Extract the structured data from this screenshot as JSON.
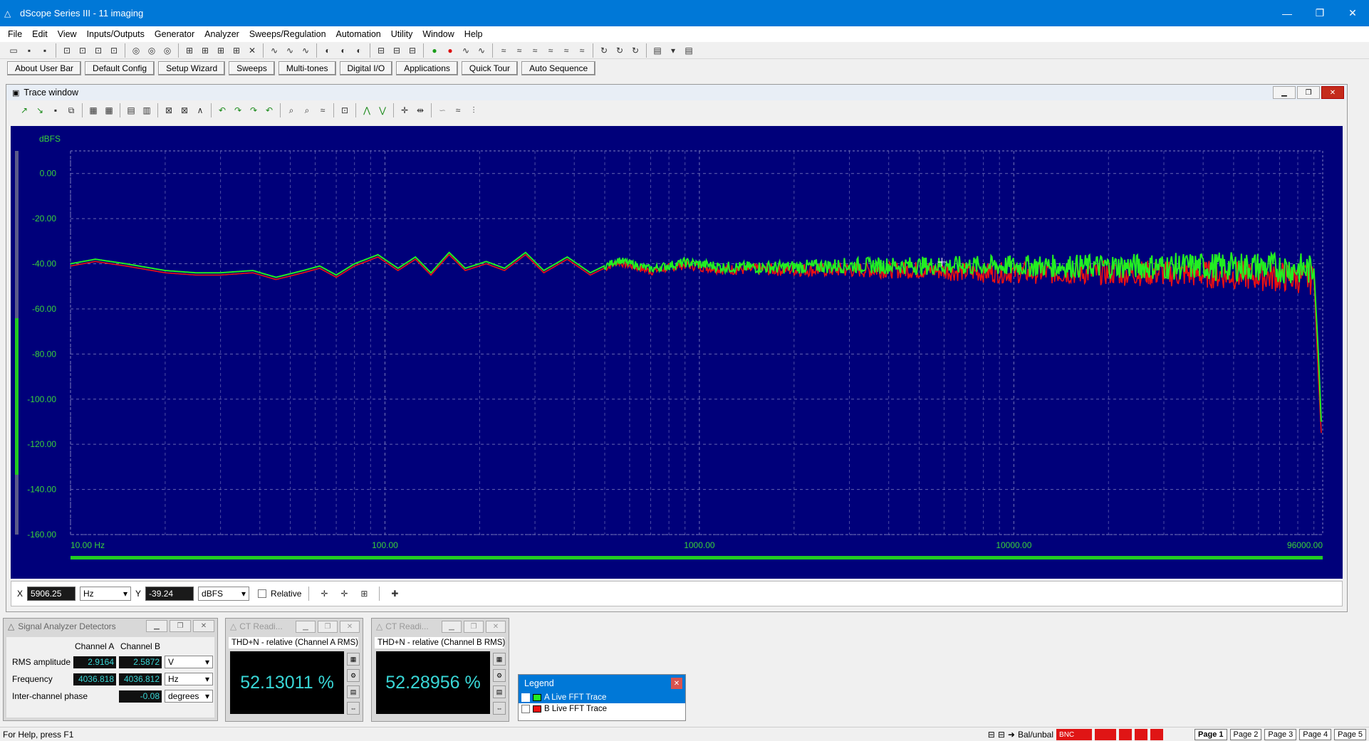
{
  "window": {
    "title": "dScope Series III - 11  imaging"
  },
  "menu": [
    "File",
    "Edit",
    "View",
    "Inputs/Outputs",
    "Generator",
    "Analyzer",
    "Sweeps/Regulation",
    "Automation",
    "Utility",
    "Window",
    "Help"
  ],
  "userbar": [
    "About User Bar",
    "Default Config",
    "Setup Wizard",
    "Sweeps",
    "Multi-tones",
    "Digital I/O",
    "Applications",
    "Quick Tour",
    "Auto Sequence"
  ],
  "trace_window": {
    "title": "Trace window"
  },
  "chart_data": {
    "type": "line",
    "ylabel": "dBFS",
    "xscale": "log",
    "xlim": [
      10,
      96000
    ],
    "ylim": [
      -160,
      10
    ],
    "xticks": [
      "10.00 Hz",
      "100.00",
      "1000.00",
      "10000.00",
      "96000.00"
    ],
    "yticks": [
      "0.00",
      "-20.00",
      "-40.00",
      "-60.00",
      "-80.00",
      "-100.00",
      "-120.00",
      "-140.00",
      "-160.00"
    ],
    "grid": true,
    "series": [
      {
        "name": "A  Live FFT Trace",
        "color": "#22ee22",
        "x": [
          10,
          12,
          15,
          20,
          25,
          30,
          38,
          45,
          55,
          62,
          70,
          80,
          95,
          110,
          125,
          140,
          160,
          180,
          210,
          240,
          280,
          320,
          380,
          450,
          550,
          700,
          900,
          1200,
          1800,
          3000,
          5000,
          8000,
          15000,
          30000,
          60000,
          85000,
          90000,
          93000,
          95000
        ],
        "values": [
          -40,
          -38,
          -40,
          -43,
          -44,
          -44,
          -43,
          -46,
          -43,
          -41,
          -45,
          -40,
          -36,
          -42,
          -37,
          -44,
          -35,
          -42,
          -39,
          -42,
          -35,
          -43,
          -37,
          -44,
          -38,
          -42,
          -39,
          -41,
          -41,
          -40,
          -40,
          -40,
          -40,
          -40,
          -40,
          -41,
          -42,
          -80,
          -110
        ]
      },
      {
        "name": "B  Live FFT Trace",
        "color": "#ee1111",
        "x": [
          10,
          12,
          15,
          20,
          25,
          30,
          38,
          45,
          55,
          62,
          70,
          80,
          95,
          110,
          125,
          140,
          160,
          180,
          210,
          240,
          280,
          320,
          380,
          450,
          550,
          700,
          900,
          1200,
          1800,
          3000,
          5000,
          8000,
          15000,
          30000,
          60000,
          85000,
          90000,
          93000,
          95000
        ],
        "values": [
          -41,
          -39,
          -41,
          -44,
          -45,
          -45,
          -44,
          -47,
          -44,
          -42,
          -46,
          -41,
          -37,
          -43,
          -38,
          -45,
          -36,
          -43,
          -40,
          -43,
          -36,
          -44,
          -38,
          -45,
          -39,
          -43,
          -40,
          -42,
          -42,
          -42,
          -42,
          -43,
          -43,
          -43,
          -44,
          -45,
          -46,
          -90,
          -115
        ]
      }
    ]
  },
  "cursor": {
    "x_label": "X",
    "x_value": "5906.25",
    "x_unit": "Hz",
    "y_label": "Y",
    "y_value": "-39.24",
    "y_unit": "dBFS",
    "relative_label": "Relative"
  },
  "detectors": {
    "title": "Signal Analyzer Detectors",
    "col_a": "Channel A",
    "col_b": "Channel B",
    "rms_label": "RMS amplitude",
    "rms_a": "2.9164",
    "rms_b": "2.5872",
    "rms_unit": "V",
    "freq_label": "Frequency",
    "freq_a": "4036.818",
    "freq_b": "4036.812",
    "freq_unit": "Hz",
    "phase_label": "Inter-channel phase",
    "phase_value": "-0.08",
    "phase_unit": "degrees"
  },
  "ct_a": {
    "title": "CT Readi...",
    "label": "THD+N - relative (Channel A RMS)",
    "value": "52.13011 %"
  },
  "ct_b": {
    "title": "CT Readi...",
    "label": "THD+N - relative (Channel B RMS)",
    "value": "52.28956 %"
  },
  "legend": {
    "title": "Legend",
    "items": [
      "A  Live FFT Trace",
      "B  Live FFT Trace"
    ]
  },
  "status": {
    "help": "For Help, press F1",
    "balunbal": "Bal/unbal",
    "bnc": "BNC",
    "pages": [
      "Page 1",
      "Page 2",
      "Page 3",
      "Page 4",
      "Page 5"
    ]
  }
}
